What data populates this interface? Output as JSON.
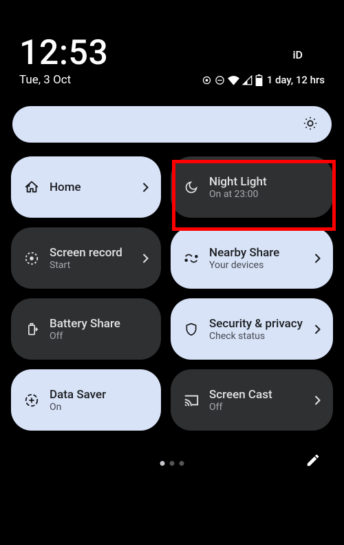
{
  "status": {
    "time": "12:53",
    "date": "Tue, 3 Oct",
    "id_label": "iD",
    "battery_text": "1 day, 12 hrs"
  },
  "tiles": {
    "home": {
      "label": "Home",
      "sub": ""
    },
    "night_light": {
      "label": "Night Light",
      "sub": "On at 23:00"
    },
    "screen_record": {
      "label": "Screen record",
      "sub": "Start"
    },
    "nearby_share": {
      "label": "Nearby Share",
      "sub": "Your devices"
    },
    "battery_share": {
      "label": "Battery Share",
      "sub": "Off"
    },
    "security": {
      "label": "Security & privacy",
      "sub": "Check status"
    },
    "data_saver": {
      "label": "Data Saver",
      "sub": "On"
    },
    "screen_cast": {
      "label": "Screen Cast",
      "sub": "Off"
    }
  }
}
